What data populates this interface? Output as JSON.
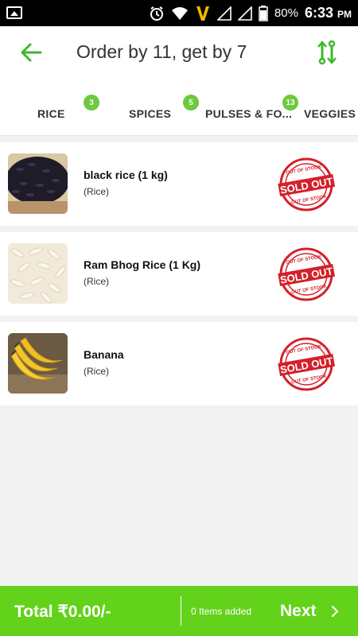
{
  "status_bar": {
    "battery": "80%",
    "time": "6:33",
    "ampm": "PM"
  },
  "header": {
    "title": "Order by 11, get by 7",
    "back_icon": "arrow-left-icon",
    "swap_icon": "swap-vertical-icon",
    "accent": "#3db72c"
  },
  "tabs": [
    {
      "label": "RICE",
      "badge": "3"
    },
    {
      "label": "SPICES",
      "badge": "5"
    },
    {
      "label": "PULSES & FO...",
      "badge": "13"
    },
    {
      "label": "VEGGIES A"
    }
  ],
  "products": [
    {
      "name": "black rice (1 kg)",
      "category": "(Rice)",
      "status": "SOLD OUT",
      "stamp_top": "OUT OF STOCK",
      "stamp_bottom": "OUT OF STOCK"
    },
    {
      "name": "Ram Bhog Rice (1 Kg)",
      "category": "(Rice)",
      "status": "SOLD OUT",
      "stamp_top": "OUT OF STOCK",
      "stamp_bottom": "OUT OF STOCK"
    },
    {
      "name": "Banana",
      "category": "(Rice)",
      "status": "SOLD OUT",
      "stamp_top": "OUT OF STOCK",
      "stamp_bottom": "OUT OF STOCK"
    }
  ],
  "bottom_bar": {
    "total": "Total ₹0.00/-",
    "items_added": "0 Items added",
    "next": "Next",
    "color": "#63d21b"
  }
}
